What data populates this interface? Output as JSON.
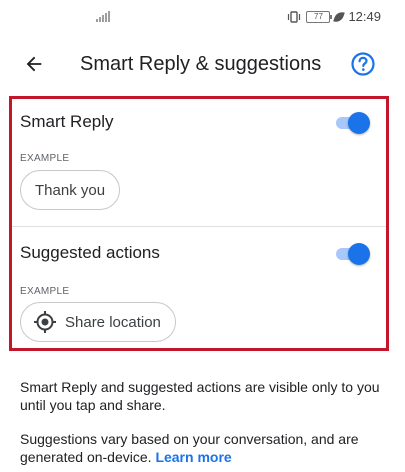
{
  "status_bar": {
    "time": "12:49",
    "battery": "77"
  },
  "header": {
    "title": "Smart Reply & suggestions"
  },
  "smart_reply": {
    "label": "Smart Reply",
    "example_label": "EXAMPLE",
    "example_chip": "Thank you",
    "enabled": true
  },
  "suggested_actions": {
    "label": "Suggested actions",
    "example_label": "EXAMPLE",
    "example_chip": "Share location",
    "enabled": true
  },
  "info": {
    "paragraph1": "Smart Reply and suggested actions are visible only to you until you tap and share.",
    "paragraph2": "Suggestions vary based on your conversation, and are generated on-device.",
    "learn_more": "Learn more"
  },
  "colors": {
    "accent": "#1a73e8",
    "highlight": "#c4162a"
  }
}
